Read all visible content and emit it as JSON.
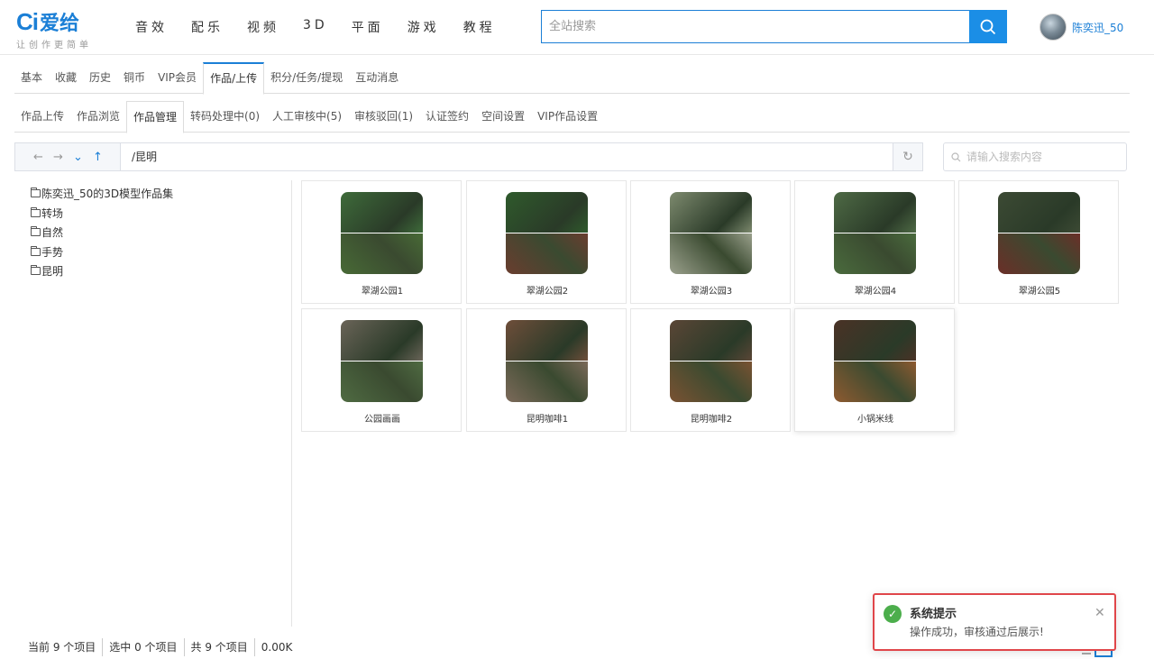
{
  "header": {
    "logo_ci": "Ci",
    "logo_name": "爱给",
    "slogan": "让创作更简单",
    "nav": [
      "音效",
      "配乐",
      "视频",
      "3D",
      "平面",
      "游戏",
      "教程"
    ],
    "search_placeholder": "全站搜索",
    "username": "陈奕迅_50"
  },
  "tabs_primary": [
    "基本",
    "收藏",
    "历史",
    "铜币",
    "VIP会员",
    "作品/上传",
    "积分/任务/提现",
    "互动消息"
  ],
  "tabs_primary_active": "作品/上传",
  "tabs_secondary": [
    "作品上传",
    "作品浏览",
    "作品管理",
    "转码处理中(0)",
    "人工审核中(5)",
    "审核驳回(1)",
    "认证签约",
    "空间设置",
    "VIP作品设置"
  ],
  "tabs_secondary_active": "作品管理",
  "toolbar": {
    "path": "/昆明",
    "search_placeholder": "请输入搜索内容"
  },
  "tree": [
    "陈奕迅_50的3D模型作品集",
    "转场",
    "自然",
    "手势",
    "昆明"
  ],
  "items": [
    {
      "label": "翠湖公园1",
      "top": "#3e6b3a",
      "bot": "#486a36"
    },
    {
      "label": "翠湖公园2",
      "top": "#2f5a2c",
      "bot": "#6a3d2f"
    },
    {
      "label": "翠湖公园3",
      "top": "#7d8a6e",
      "bot": "#9aa08c"
    },
    {
      "label": "翠湖公园4",
      "top": "#4e6a45",
      "bot": "#4a6b3d"
    },
    {
      "label": "翠湖公园5",
      "top": "#3c4a34",
      "bot": "#6b2f28"
    },
    {
      "label": "公园画画",
      "top": "#6a6458",
      "bot": "#4f6b42"
    },
    {
      "label": "昆明咖啡1",
      "top": "#6e4e3a",
      "bot": "#7c6a5a"
    },
    {
      "label": "昆明咖啡2",
      "top": "#5a4636",
      "bot": "#7a5232"
    },
    {
      "label": "小锅米线",
      "top": "#4a3226",
      "bot": "#8e5a30"
    }
  ],
  "status": {
    "current": "当前 9 个项目",
    "selected": "选中 0 个项目",
    "total": "共 9 个项目",
    "size": "0.00K"
  },
  "notification": {
    "title": "系统提示",
    "message": "操作成功，审核通过后展示!"
  },
  "colors": {
    "brand": "#1b7fd6",
    "success": "#4cae4c",
    "highlight_border": "#e0464a"
  }
}
